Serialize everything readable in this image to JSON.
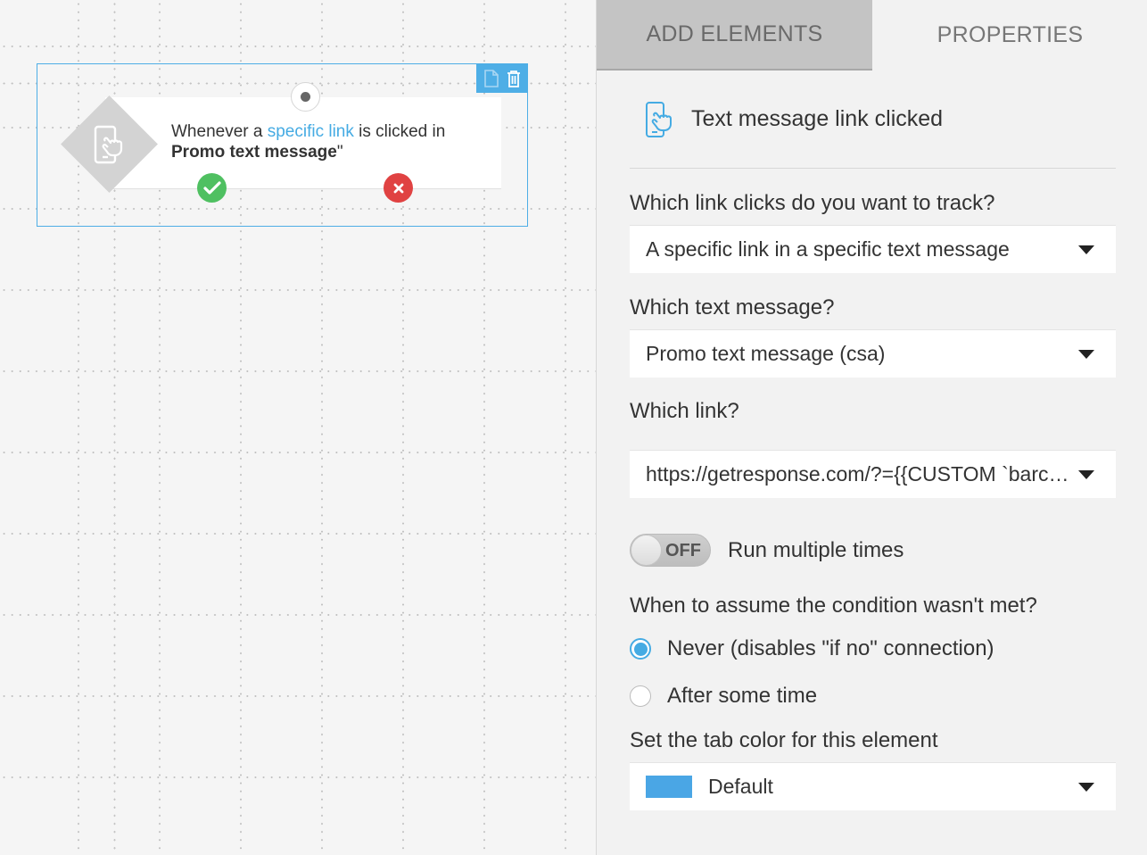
{
  "canvas": {
    "node": {
      "text_prefix": "Whenever a ",
      "text_link": "specific link",
      "text_middle": " is clicked in",
      "text_bold": "Promo text message",
      "text_suffix": "\"",
      "icon": "phone-tap-icon",
      "yes_icon": "check-icon",
      "no_icon": "x-icon"
    },
    "toolbar": {
      "copy_icon": "document-icon",
      "delete_icon": "trash-icon"
    }
  },
  "panel": {
    "tabs": [
      {
        "label": "ADD ELEMENTS",
        "active": false
      },
      {
        "label": "PROPERTIES",
        "active": true
      }
    ],
    "header": {
      "icon": "phone-tap-icon",
      "title": "Text message link clicked"
    },
    "fields": {
      "track_label": "Which link clicks do you want to track?",
      "track_value": "A specific link in a specific text message",
      "message_label": "Which text message?",
      "message_value": "Promo text message (csa)",
      "link_label": "Which link?",
      "link_value": "https://getresponse.com/?={{CUSTOM `barcode`}}",
      "toggle_state": "OFF",
      "toggle_label": "Run multiple times",
      "condition_label": "When to assume the condition wasn't met?",
      "radio_options": [
        {
          "label": "Never (disables \"if no\" connection)",
          "checked": true
        },
        {
          "label": "After some time",
          "checked": false
        }
      ],
      "color_label": "Set the tab color for this element",
      "color_value": "Default",
      "color_swatch": "#4aa6e5"
    }
  },
  "colors": {
    "accent": "#45abe3",
    "yes": "#4fc061",
    "no": "#e04242"
  }
}
